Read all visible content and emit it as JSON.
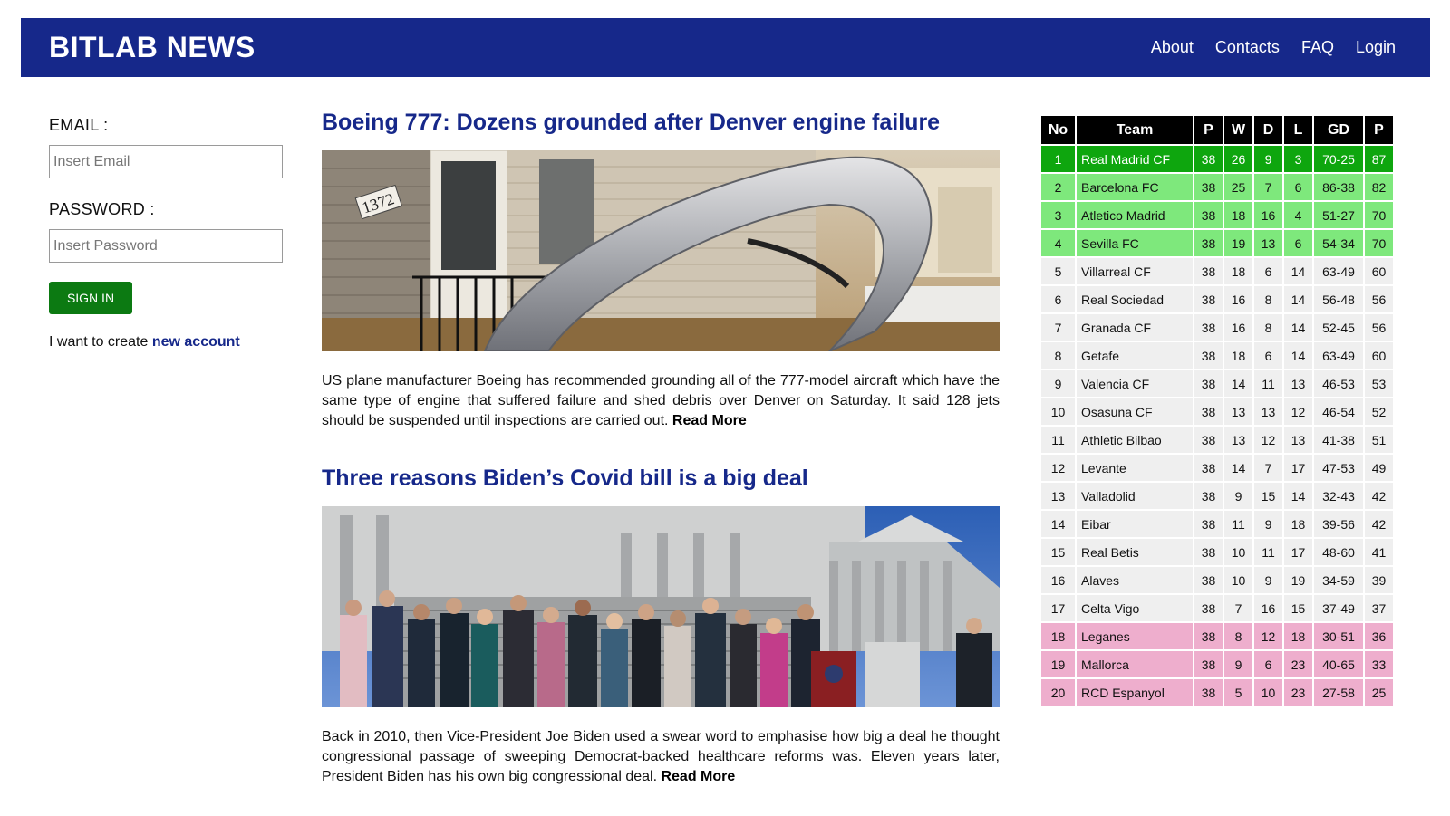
{
  "header": {
    "brand": "BITLAB NEWS",
    "nav": [
      "About",
      "Contacts",
      "FAQ",
      "Login"
    ]
  },
  "login": {
    "email_label": "EMAIL :",
    "email_placeholder": "Insert Email",
    "password_label": "PASSWORD :",
    "password_placeholder": "Insert Password",
    "signin_label": "SIGN IN",
    "create_prefix": "I want to create ",
    "create_link": "new account"
  },
  "articles": [
    {
      "title": "Boeing 777: Dozens grounded after Denver engine failure",
      "house_number": "1372",
      "body": "US plane manufacturer Boeing has recommended grounding all of the 777-model aircraft which have the same type of engine that suffered failure and shed debris over Denver on Saturday. It said 128 jets should be suspended until inspections are carried out.",
      "read_more": "Read More"
    },
    {
      "title": "Three reasons Biden’s Covid bill is a big deal",
      "body": "Back in 2010, then Vice-President Joe Biden used a swear word to emphasise how big a deal he thought congressional passage of sweeping Democrat-backed healthcare reforms was. Eleven years later, President Biden has his own big congressional deal.",
      "read_more": "Read More"
    }
  ],
  "standings": {
    "headers": [
      "No",
      "Team",
      "P",
      "W",
      "D",
      "L",
      "GD",
      "P"
    ],
    "colors": {
      "first": "#0ea60e",
      "europe": "#7ee87c",
      "mid": "#efefef",
      "relegation": "#eeaecd"
    },
    "rows": [
      {
        "zone": "first",
        "cells": [
          "1",
          "Real Madrid CF",
          "38",
          "26",
          "9",
          "3",
          "70-25",
          "87"
        ]
      },
      {
        "zone": "euro",
        "cells": [
          "2",
          "Barcelona FC",
          "38",
          "25",
          "7",
          "6",
          "86-38",
          "82"
        ]
      },
      {
        "zone": "euro",
        "cells": [
          "3",
          "Atletico Madrid",
          "38",
          "18",
          "16",
          "4",
          "51-27",
          "70"
        ]
      },
      {
        "zone": "euro",
        "cells": [
          "4",
          "Sevilla FC",
          "38",
          "19",
          "13",
          "6",
          "54-34",
          "70"
        ]
      },
      {
        "zone": "mid",
        "cells": [
          "5",
          "Villarreal CF",
          "38",
          "18",
          "6",
          "14",
          "63-49",
          "60"
        ]
      },
      {
        "zone": "mid",
        "cells": [
          "6",
          "Real Sociedad",
          "38",
          "16",
          "8",
          "14",
          "56-48",
          "56"
        ]
      },
      {
        "zone": "mid",
        "cells": [
          "7",
          "Granada CF",
          "38",
          "16",
          "8",
          "14",
          "52-45",
          "56"
        ]
      },
      {
        "zone": "mid",
        "cells": [
          "8",
          "Getafe",
          "38",
          "18",
          "6",
          "14",
          "63-49",
          "60"
        ]
      },
      {
        "zone": "mid",
        "cells": [
          "9",
          "Valencia CF",
          "38",
          "14",
          "11",
          "13",
          "46-53",
          "53"
        ]
      },
      {
        "zone": "mid",
        "cells": [
          "10",
          "Osasuna CF",
          "38",
          "13",
          "13",
          "12",
          "46-54",
          "52"
        ]
      },
      {
        "zone": "mid",
        "cells": [
          "11",
          "Athletic Bilbao",
          "38",
          "13",
          "12",
          "13",
          "41-38",
          "51"
        ]
      },
      {
        "zone": "mid",
        "cells": [
          "12",
          "Levante",
          "38",
          "14",
          "7",
          "17",
          "47-53",
          "49"
        ]
      },
      {
        "zone": "mid",
        "cells": [
          "13",
          "Valladolid",
          "38",
          "9",
          "15",
          "14",
          "32-43",
          "42"
        ]
      },
      {
        "zone": "mid",
        "cells": [
          "14",
          "Eibar",
          "38",
          "11",
          "9",
          "18",
          "39-56",
          "42"
        ]
      },
      {
        "zone": "mid",
        "cells": [
          "15",
          "Real Betis",
          "38",
          "10",
          "11",
          "17",
          "48-60",
          "41"
        ]
      },
      {
        "zone": "mid",
        "cells": [
          "16",
          "Alaves",
          "38",
          "10",
          "9",
          "19",
          "34-59",
          "39"
        ]
      },
      {
        "zone": "mid",
        "cells": [
          "17",
          "Celta Vigo",
          "38",
          "7",
          "16",
          "15",
          "37-49",
          "37"
        ]
      },
      {
        "zone": "rel",
        "cells": [
          "18",
          "Leganes",
          "38",
          "8",
          "12",
          "18",
          "30-51",
          "36"
        ]
      },
      {
        "zone": "rel",
        "cells": [
          "19",
          "Mallorca",
          "38",
          "9",
          "6",
          "23",
          "40-65",
          "33"
        ]
      },
      {
        "zone": "rel",
        "cells": [
          "20",
          "RCD Espanyol",
          "38",
          "5",
          "10",
          "23",
          "27-58",
          "25"
        ]
      }
    ]
  }
}
